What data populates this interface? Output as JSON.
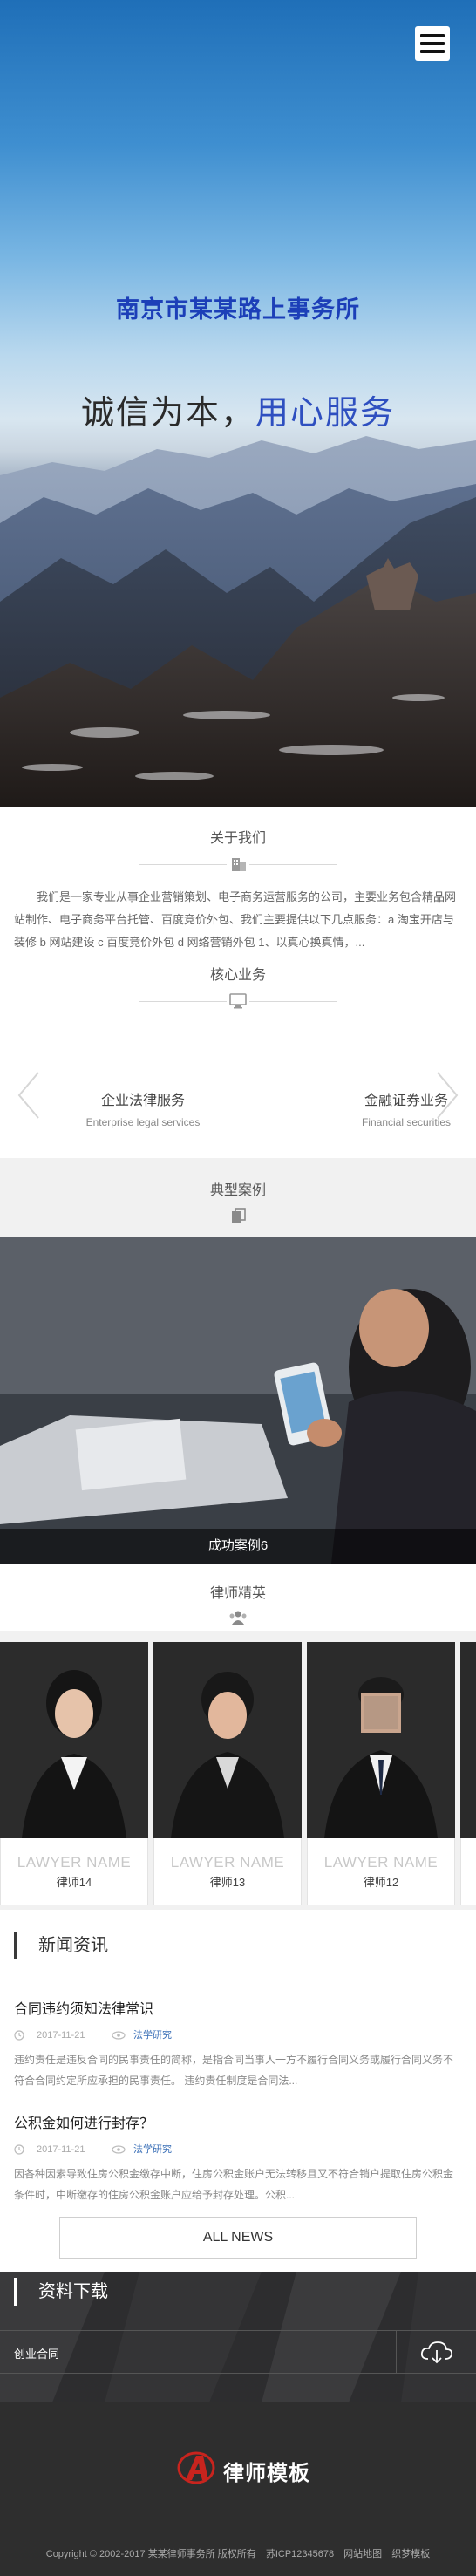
{
  "hero": {
    "title": "南京市某某路上事务所",
    "slogan_main": "诚信为本，",
    "slogan_accent": "用心服务"
  },
  "about": {
    "title": "关于我们",
    "text": "我们是一家专业从事企业营销策划、电子商务运营服务的公司，主要业务包含精品网站制作、电子商务平台托管、百度竞价外包、我们主要提供以下几点服务：a 淘宝开店与装修 b 网站建设 c 百度竞价外包 d 网络营销外包 1、以真心换真情，..."
  },
  "business": {
    "title": "核心业务",
    "items": [
      {
        "cn": "企业法律服务",
        "en": "Enterprise legal services"
      },
      {
        "cn": "金融证券业务",
        "en": "Financial securities"
      }
    ]
  },
  "cases": {
    "title": "典型案例",
    "caption": "成功案例6"
  },
  "lawyers": {
    "title": "律师精英",
    "items": [
      {
        "placeholder": "LAWYER NAME",
        "name": "律师14"
      },
      {
        "placeholder": "LAWYER NAME",
        "name": "律师13"
      },
      {
        "placeholder": "LAWYER NAME",
        "name": "律师12"
      }
    ]
  },
  "news": {
    "title": "新闻资讯",
    "items": [
      {
        "title": "合同违约须知法律常识",
        "date": "2017-11-21",
        "category": "法学研究",
        "desc": "违约责任是违反合同的民事责任的简称，是指合同当事人一方不履行合同义务或履行合同义务不符合合同约定所应承担的民事责任。 违约责任制度是合同法..."
      },
      {
        "title": "公积金如何进行封存？",
        "date": "2017-11-21",
        "category": "法学研究",
        "desc": "因各种因素导致住房公积金缴存中断，住房公积金账户无法转移且又不符合销户提取住房公积金条件时，中断缴存的住房公积金账户应给予封存处理。公积..."
      }
    ],
    "all_label": "ALL NEWS"
  },
  "downloads": {
    "title": "资料下载",
    "items": [
      {
        "name": "创业合同"
      }
    ]
  },
  "footer": {
    "logo_text": "律师模板",
    "copyright": "Copyright © 2002-2017 某某律师事务所 版权所有",
    "links": [
      "苏ICP12345678",
      "网站地图",
      "织梦模板"
    ]
  },
  "colors": {
    "accent_blue": "#2e4fc0",
    "logo_red": "#c8241e",
    "footer_bg": "#2e2e2e"
  }
}
